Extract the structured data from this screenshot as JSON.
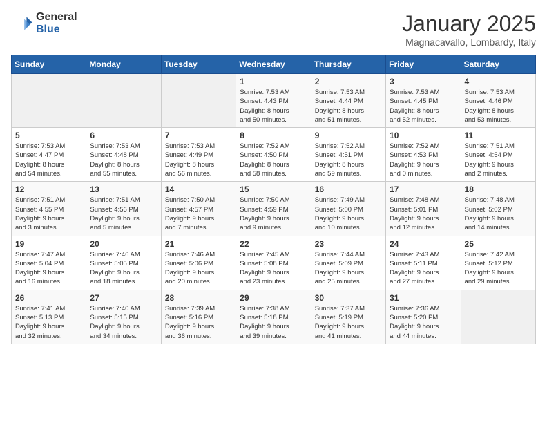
{
  "logo": {
    "general": "General",
    "blue": "Blue"
  },
  "header": {
    "month": "January 2025",
    "location": "Magnacavallo, Lombardy, Italy"
  },
  "weekdays": [
    "Sunday",
    "Monday",
    "Tuesday",
    "Wednesday",
    "Thursday",
    "Friday",
    "Saturday"
  ],
  "weeks": [
    [
      {
        "day": "",
        "info": ""
      },
      {
        "day": "",
        "info": ""
      },
      {
        "day": "",
        "info": ""
      },
      {
        "day": "1",
        "info": "Sunrise: 7:53 AM\nSunset: 4:43 PM\nDaylight: 8 hours\nand 50 minutes."
      },
      {
        "day": "2",
        "info": "Sunrise: 7:53 AM\nSunset: 4:44 PM\nDaylight: 8 hours\nand 51 minutes."
      },
      {
        "day": "3",
        "info": "Sunrise: 7:53 AM\nSunset: 4:45 PM\nDaylight: 8 hours\nand 52 minutes."
      },
      {
        "day": "4",
        "info": "Sunrise: 7:53 AM\nSunset: 4:46 PM\nDaylight: 8 hours\nand 53 minutes."
      }
    ],
    [
      {
        "day": "5",
        "info": "Sunrise: 7:53 AM\nSunset: 4:47 PM\nDaylight: 8 hours\nand 54 minutes."
      },
      {
        "day": "6",
        "info": "Sunrise: 7:53 AM\nSunset: 4:48 PM\nDaylight: 8 hours\nand 55 minutes."
      },
      {
        "day": "7",
        "info": "Sunrise: 7:53 AM\nSunset: 4:49 PM\nDaylight: 8 hours\nand 56 minutes."
      },
      {
        "day": "8",
        "info": "Sunrise: 7:52 AM\nSunset: 4:50 PM\nDaylight: 8 hours\nand 58 minutes."
      },
      {
        "day": "9",
        "info": "Sunrise: 7:52 AM\nSunset: 4:51 PM\nDaylight: 8 hours\nand 59 minutes."
      },
      {
        "day": "10",
        "info": "Sunrise: 7:52 AM\nSunset: 4:53 PM\nDaylight: 9 hours\nand 0 minutes."
      },
      {
        "day": "11",
        "info": "Sunrise: 7:51 AM\nSunset: 4:54 PM\nDaylight: 9 hours\nand 2 minutes."
      }
    ],
    [
      {
        "day": "12",
        "info": "Sunrise: 7:51 AM\nSunset: 4:55 PM\nDaylight: 9 hours\nand 3 minutes."
      },
      {
        "day": "13",
        "info": "Sunrise: 7:51 AM\nSunset: 4:56 PM\nDaylight: 9 hours\nand 5 minutes."
      },
      {
        "day": "14",
        "info": "Sunrise: 7:50 AM\nSunset: 4:57 PM\nDaylight: 9 hours\nand 7 minutes."
      },
      {
        "day": "15",
        "info": "Sunrise: 7:50 AM\nSunset: 4:59 PM\nDaylight: 9 hours\nand 9 minutes."
      },
      {
        "day": "16",
        "info": "Sunrise: 7:49 AM\nSunset: 5:00 PM\nDaylight: 9 hours\nand 10 minutes."
      },
      {
        "day": "17",
        "info": "Sunrise: 7:48 AM\nSunset: 5:01 PM\nDaylight: 9 hours\nand 12 minutes."
      },
      {
        "day": "18",
        "info": "Sunrise: 7:48 AM\nSunset: 5:02 PM\nDaylight: 9 hours\nand 14 minutes."
      }
    ],
    [
      {
        "day": "19",
        "info": "Sunrise: 7:47 AM\nSunset: 5:04 PM\nDaylight: 9 hours\nand 16 minutes."
      },
      {
        "day": "20",
        "info": "Sunrise: 7:46 AM\nSunset: 5:05 PM\nDaylight: 9 hours\nand 18 minutes."
      },
      {
        "day": "21",
        "info": "Sunrise: 7:46 AM\nSunset: 5:06 PM\nDaylight: 9 hours\nand 20 minutes."
      },
      {
        "day": "22",
        "info": "Sunrise: 7:45 AM\nSunset: 5:08 PM\nDaylight: 9 hours\nand 23 minutes."
      },
      {
        "day": "23",
        "info": "Sunrise: 7:44 AM\nSunset: 5:09 PM\nDaylight: 9 hours\nand 25 minutes."
      },
      {
        "day": "24",
        "info": "Sunrise: 7:43 AM\nSunset: 5:11 PM\nDaylight: 9 hours\nand 27 minutes."
      },
      {
        "day": "25",
        "info": "Sunrise: 7:42 AM\nSunset: 5:12 PM\nDaylight: 9 hours\nand 29 minutes."
      }
    ],
    [
      {
        "day": "26",
        "info": "Sunrise: 7:41 AM\nSunset: 5:13 PM\nDaylight: 9 hours\nand 32 minutes."
      },
      {
        "day": "27",
        "info": "Sunrise: 7:40 AM\nSunset: 5:15 PM\nDaylight: 9 hours\nand 34 minutes."
      },
      {
        "day": "28",
        "info": "Sunrise: 7:39 AM\nSunset: 5:16 PM\nDaylight: 9 hours\nand 36 minutes."
      },
      {
        "day": "29",
        "info": "Sunrise: 7:38 AM\nSunset: 5:18 PM\nDaylight: 9 hours\nand 39 minutes."
      },
      {
        "day": "30",
        "info": "Sunrise: 7:37 AM\nSunset: 5:19 PM\nDaylight: 9 hours\nand 41 minutes."
      },
      {
        "day": "31",
        "info": "Sunrise: 7:36 AM\nSunset: 5:20 PM\nDaylight: 9 hours\nand 44 minutes."
      },
      {
        "day": "",
        "info": ""
      }
    ]
  ]
}
